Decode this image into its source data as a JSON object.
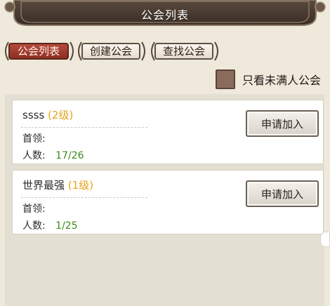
{
  "header": {
    "title": "公会列表"
  },
  "tabs": [
    {
      "label": "公会列表",
      "active": true
    },
    {
      "label": "创建公会",
      "active": false
    },
    {
      "label": "查找公会",
      "active": false
    }
  ],
  "filter": {
    "label": "只看未满人公会",
    "checked": false
  },
  "guilds": [
    {
      "name": "ssss",
      "level": "(2级)",
      "leader_label": "首领:",
      "members_label": "人数:",
      "members": "17/26",
      "join_label": "申请加入"
    },
    {
      "name": "世界最强",
      "level": "(1级)",
      "leader_label": "首领:",
      "members_label": "人数:",
      "members": "1/25",
      "join_label": "申请加入"
    }
  ],
  "colors": {
    "header_bg": "#4a3a30",
    "active_tab": "#9d3a2d",
    "level_text": "#e6a21a",
    "member_count": "#3d8a1a",
    "checkbox_fill": "#8b6c5c"
  }
}
